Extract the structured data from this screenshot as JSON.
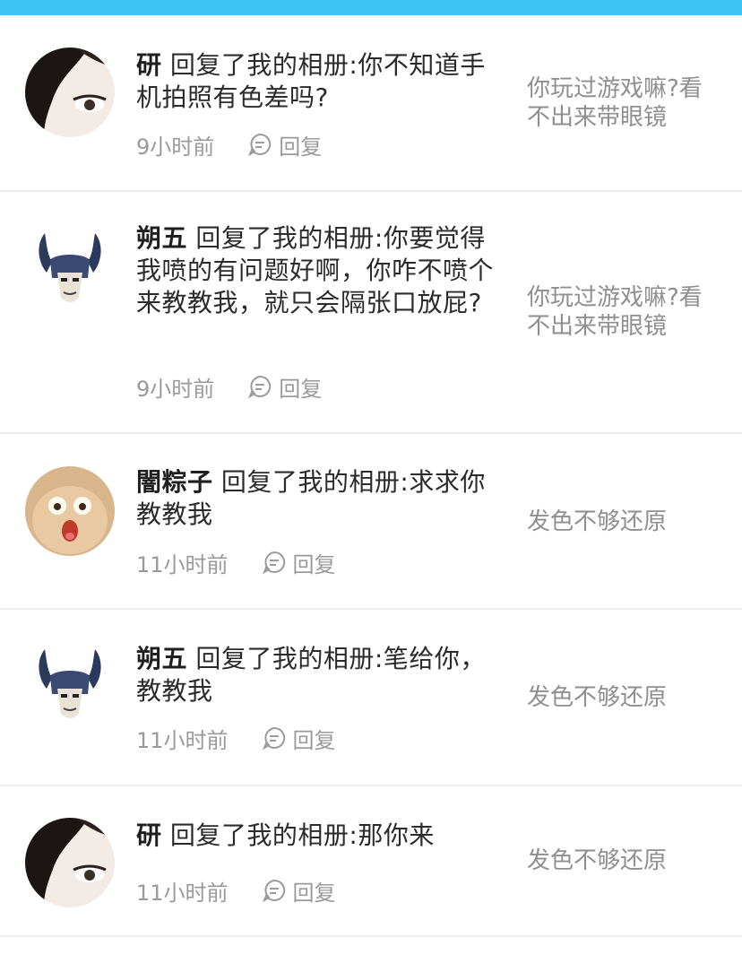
{
  "notifications": [
    {
      "avatar": "girl-avatar",
      "name": "研",
      "action": "回复了我的相册:",
      "text": "你不知道手机拍照有色差吗?",
      "time": "9小时前",
      "reply_label": "回复",
      "quote": "你玩过游戏嘛?看不出来带眼镜"
    },
    {
      "avatar": "horned-helmet-avatar",
      "name": "朔五",
      "action": "回复了我的相册:",
      "text": "你要觉得我喷的有问题好啊，你咋不喷个来教教我，就只会隔张口放屁?",
      "time": "9小时前",
      "reply_label": "回复",
      "quote": "你玩过游戏嘛?看不出来带眼镜"
    },
    {
      "avatar": "cat-avatar",
      "name": "闇粽子",
      "action": "回复了我的相册:",
      "text": "求求你教教我",
      "time": "11小时前",
      "reply_label": "回复",
      "quote": "发色不够还原"
    },
    {
      "avatar": "horned-helmet-avatar",
      "name": "朔五",
      "action": "回复了我的相册:",
      "text": "笔给你，教教我",
      "time": "11小时前",
      "reply_label": "回复",
      "quote": "发色不够还原"
    },
    {
      "avatar": "girl-avatar",
      "name": "研",
      "action": "回复了我的相册:",
      "text": "那你来",
      "time": "11小时前",
      "reply_label": "回复",
      "quote": "发色不够还原"
    }
  ],
  "colors": {
    "accent": "#3ec4f4",
    "meta": "#9a9a9a",
    "divider": "#ececec"
  }
}
